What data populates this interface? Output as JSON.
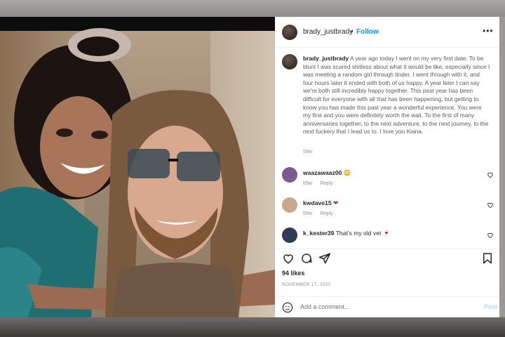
{
  "post": {
    "username": "brady_justbrady",
    "follow_label": "Follow",
    "separator": "•",
    "more_label": "•••"
  },
  "caption": {
    "username": "brady_justbrady",
    "text": "A year ago today I went on my very first date. To be blunt I was scared shitless about what it would be like, especially since I was meeting a random girl through tinder. I went through with it, and four hours later it ended with both of us happy. A year later I can say we're both still incredibly happy together. This past year has been difficult for everyone with all that has been happening, but getting to know you has made this past year a wonderful experience. You were my first and you were definitely worth the wait. To the first of many anniversaries together, to the next adventure, to the next journey, to the next fuckery that I lead us to. I love you Kiana.",
    "time": "59w"
  },
  "comments": [
    {
      "username": "waazawaaz00",
      "text": "",
      "emoji": "😳",
      "time": "59w",
      "reply": "Reply",
      "avatar_color": "#7b5b8f"
    },
    {
      "username": "kwdave15",
      "text": "",
      "emoji": "❤",
      "time": "59w",
      "reply": "Reply",
      "avatar_color": "#c9a88d"
    },
    {
      "username": "k_kester39",
      "text": "That's my old vet",
      "emoji": "🍷",
      "time": "",
      "reply": "",
      "avatar_color": "#2f3b57"
    }
  ],
  "actions": {
    "likes": "94 likes",
    "date": "NOVEMBER 17, 2020"
  },
  "add_comment": {
    "placeholder": "Add a comment...",
    "post_label": "Post"
  },
  "icons": [
    "more-icon",
    "heart-icon",
    "comment-icon",
    "share-icon",
    "bookmark-icon",
    "emoji-icon"
  ],
  "colors": {
    "follow": "#0095f6",
    "post_disabled": "#b2dffc",
    "heart_red": "#c0392b"
  }
}
